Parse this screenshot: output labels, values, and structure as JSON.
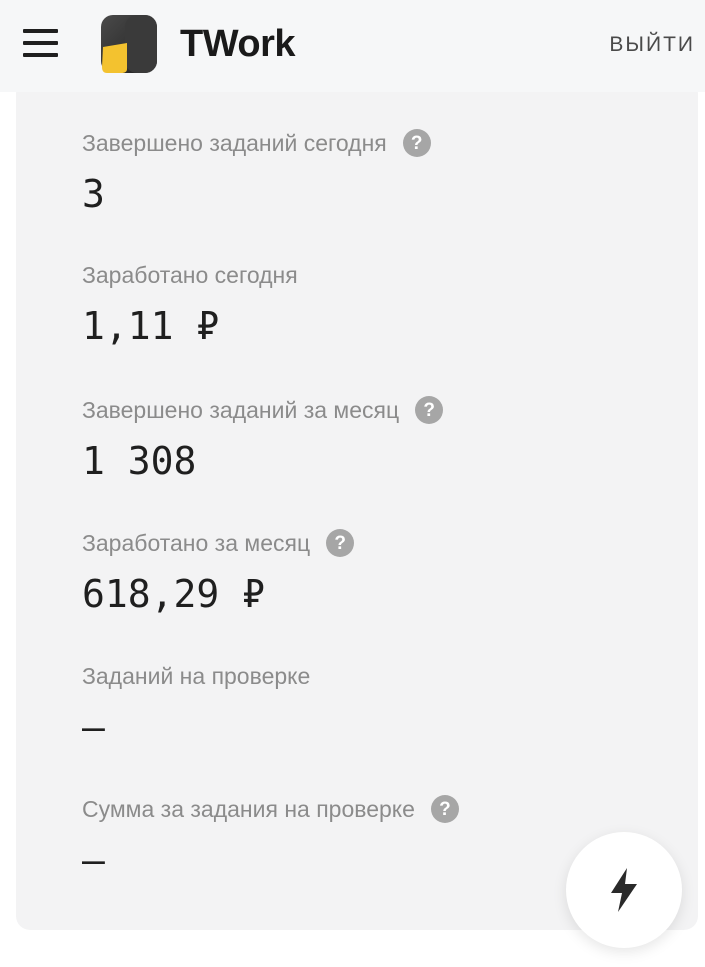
{
  "header": {
    "brand": "TWork",
    "logout_label": "ВЫЙТИ"
  },
  "stats": [
    {
      "label": "Завершено заданий сегодня",
      "value": "3",
      "help": "?"
    },
    {
      "label": "Заработано сегодня",
      "value": "1,11 ₽"
    },
    {
      "label": "Завершено заданий за месяц",
      "value": "1 308",
      "help": "?"
    },
    {
      "label": "Заработано за месяц",
      "value": "618,29 ₽",
      "help": "?"
    },
    {
      "label": "Заданий на проверке",
      "value": "–"
    },
    {
      "label": "Сумма за задания на проверке",
      "value": "–",
      "help": "?"
    }
  ],
  "icons": {
    "menu": "hamburger-menu-icon",
    "logo": "twork-logo-icon",
    "help": "question-circle-icon",
    "fab": "lightning-bolt-icon"
  },
  "colors": {
    "header_bg": "#f6f7f8",
    "card_bg": "#f3f3f4",
    "logo_yellow": "#f3c22f",
    "logo_dark": "#2b2b2b",
    "label_gray": "#8b8b8b",
    "value_dark": "#1f1f1f"
  }
}
